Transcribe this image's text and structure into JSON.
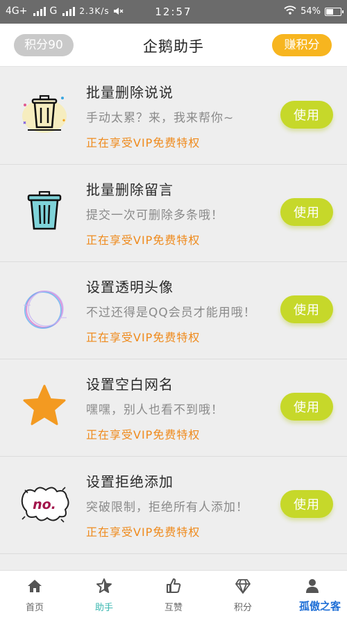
{
  "status_bar": {
    "network_1": "4G+",
    "network_2": "G",
    "speed": "2.3K/s",
    "time": "12:57",
    "battery": "54%",
    "battery_level": 0.54
  },
  "header": {
    "points_label": "积分90",
    "title": "企鹅助手",
    "earn_label": "赚积分"
  },
  "items": [
    {
      "icon": "trash-sparkle-icon",
      "title": "批量删除说说",
      "desc": "手动太累？来，我来帮你~",
      "vip": "正在享受VIP免费特权",
      "button": "使用"
    },
    {
      "icon": "trash-icon",
      "title": "批量删除留言",
      "desc": "提交一次可删除多条哦！",
      "vip": "正在享受VIP免费特权",
      "button": "使用"
    },
    {
      "icon": "transparent-circle-icon",
      "title": "设置透明头像",
      "desc": "不过还得是QQ会员才能用哦！",
      "vip": "正在享受VIP免费特权",
      "button": "使用"
    },
    {
      "icon": "star-icon",
      "title": "设置空白网名",
      "desc": "嘿嘿，别人也看不到哦！",
      "vip": "正在享受VIP免费特权",
      "button": "使用"
    },
    {
      "icon": "no-badge-icon",
      "title": "设置拒绝添加",
      "desc": "突破限制，拒绝所有人添加！",
      "vip": "正在享受VIP免费特权",
      "button": "使用"
    }
  ],
  "bottom_nav": [
    {
      "icon": "home-icon",
      "label": "首页"
    },
    {
      "icon": "star-nav-icon",
      "label": "助手",
      "active": true
    },
    {
      "icon": "thumbs-up-icon",
      "label": "互赞"
    },
    {
      "icon": "diamond-icon",
      "label": "积分"
    },
    {
      "icon": "person-icon",
      "label": ""
    }
  ],
  "watermark": "孤傲之客",
  "colors": {
    "accent_green": "#c6d82a",
    "earn_orange": "#f7b51f",
    "vip_orange": "#ef8a1c",
    "nav_active": "#3ab7b0"
  }
}
